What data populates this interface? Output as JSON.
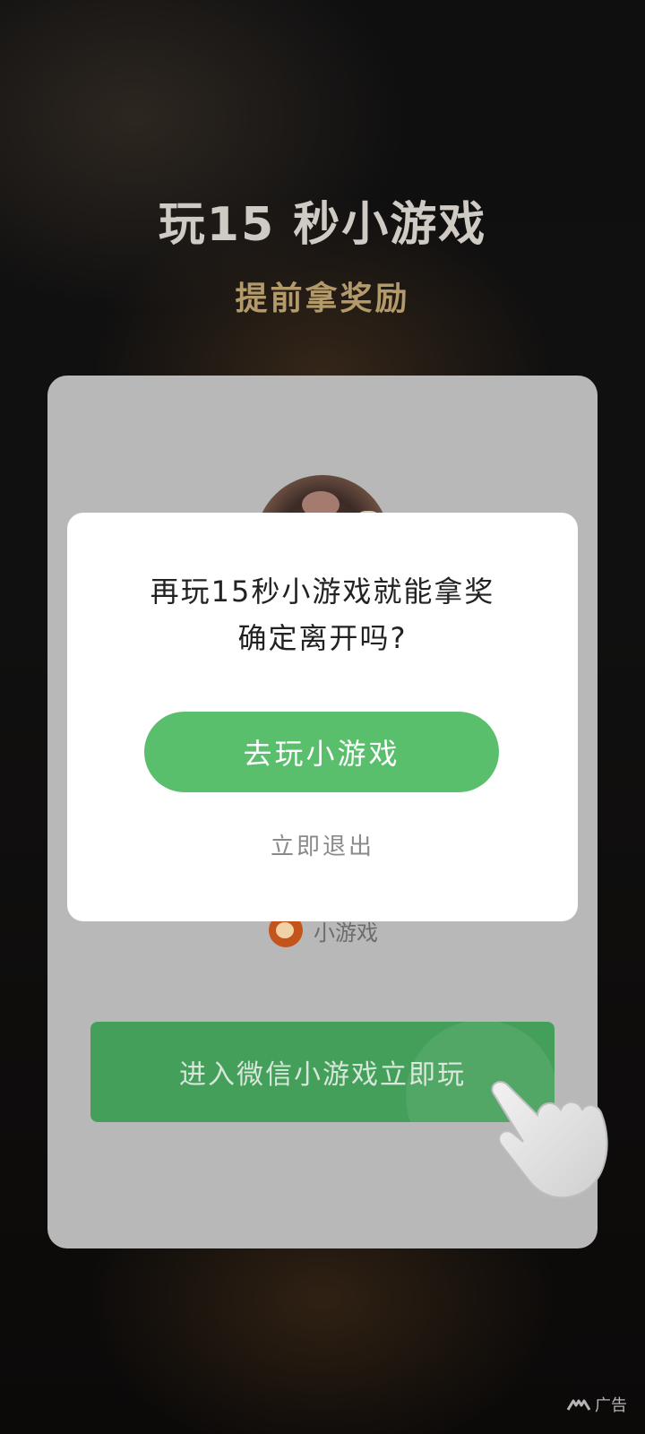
{
  "header": {
    "title": "玩15 秒小游戏",
    "subtitle": "提前拿奖励"
  },
  "card": {
    "game_brand_label": "小游戏",
    "enter_button_label": "进入微信小游戏立即玩"
  },
  "dialog": {
    "message_line1": "再玩15秒小游戏就能拿奖",
    "message_line2": "确定离开吗?",
    "confirm_label": "去玩小游戏",
    "exit_label": "立即退出"
  },
  "ad": {
    "label": "广告"
  },
  "colors": {
    "primary_green": "#5abf6c",
    "enter_green": "#449f5a",
    "subtitle_gold": "#b39a6a"
  }
}
